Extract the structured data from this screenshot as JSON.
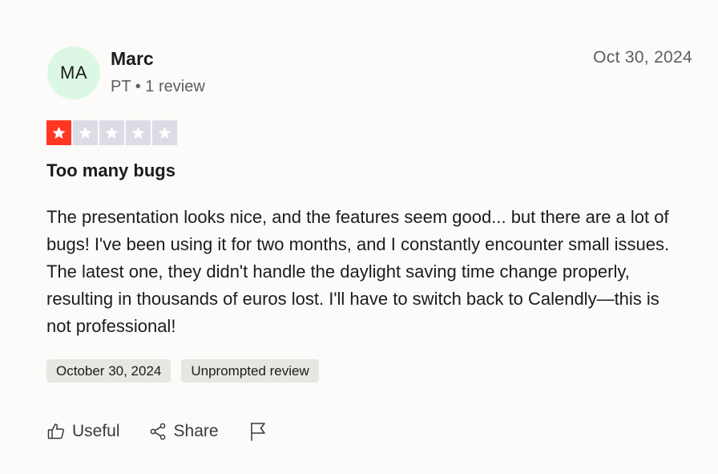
{
  "reviewer": {
    "initials": "MA",
    "name": "Marc",
    "meta": "PT • 1 review"
  },
  "review": {
    "date": "Oct 30, 2024",
    "rating": 1,
    "rating_max": 5,
    "title": "Too many bugs",
    "body": "The presentation looks nice, and the features seem good... but there are a lot of bugs! I've been using it for two months, and I constantly encounter small issues. The latest one, they didn't handle the daylight saving time change properly, resulting in thousands of euros lost. I'll have to switch back to Calendly—this is not professional!"
  },
  "tags": {
    "experience_date": "October 30, 2024",
    "review_type": "Unprompted review"
  },
  "actions": {
    "useful_label": "Useful",
    "share_label": "Share",
    "report_icon": "flag-icon"
  },
  "colors": {
    "star_filled": "#ff3722",
    "star_empty": "#dcdce6",
    "avatar_bg": "#dcf8e4"
  }
}
